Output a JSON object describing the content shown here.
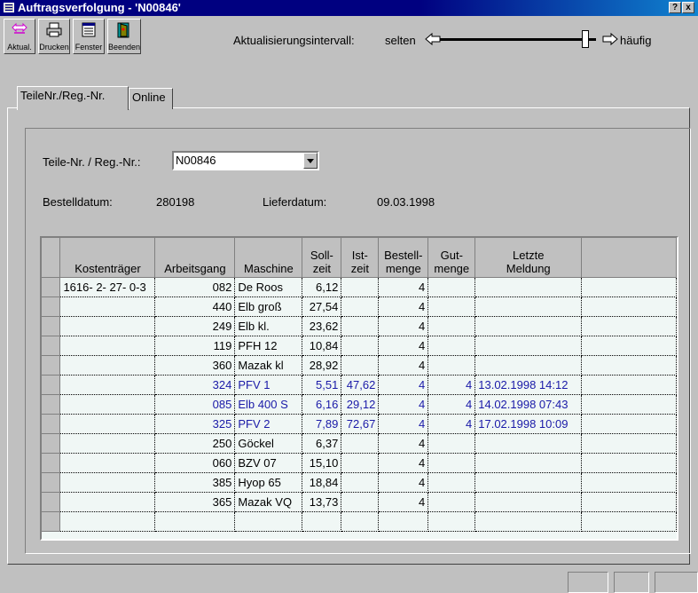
{
  "window": {
    "title": "Auftragsverfolgung - 'N00846'",
    "help_label": "?",
    "close_label": "x"
  },
  "toolbar": {
    "buttons": [
      {
        "label": "Aktual.",
        "icon": "refresh-arrows-icon"
      },
      {
        "label": "Drucken",
        "icon": "printer-icon"
      },
      {
        "label": "Fenster",
        "icon": "window-icon"
      },
      {
        "label": "Beenden",
        "icon": "exit-door-icon"
      }
    ],
    "interval_label": "Aktualisierungsintervall:",
    "slider_left_label": "selten",
    "slider_right_label": "häufig",
    "slider_position": 0.93
  },
  "tabs": [
    {
      "label": "TeileNr./Reg.-Nr.",
      "active": true
    },
    {
      "label": "Online",
      "active": false
    }
  ],
  "form": {
    "part_label": "Teile-Nr. / Reg.-Nr.:",
    "part_value": "N00846",
    "order_date_label": "Bestelldatum:",
    "order_date_value": "280198",
    "delivery_date_label": "Lieferdatum:",
    "delivery_date_value": "09.03.1998"
  },
  "table": {
    "headers": [
      {
        "l1": "",
        "l2": "Kostenträger"
      },
      {
        "l1": "",
        "l2": "Arbeitsgang"
      },
      {
        "l1": "",
        "l2": "Maschine"
      },
      {
        "l1": "Soll-",
        "l2": "zeit"
      },
      {
        "l1": "Ist-",
        "l2": "zeit"
      },
      {
        "l1": "Bestell-",
        "l2": "menge"
      },
      {
        "l1": "Gut-",
        "l2": "menge"
      },
      {
        "l1": "Letzte",
        "l2": "Meldung"
      }
    ],
    "rows": [
      {
        "kt": "1616- 2- 27- 0-3",
        "ag": "082",
        "ma": "De Roos",
        "soll": "6,12",
        "ist": "",
        "best": "4",
        "gut": "",
        "meld": "",
        "hl": false
      },
      {
        "kt": "",
        "ag": "440",
        "ma": "Elb groß",
        "soll": "27,54",
        "ist": "",
        "best": "4",
        "gut": "",
        "meld": "",
        "hl": false
      },
      {
        "kt": "",
        "ag": "249",
        "ma": "Elb kl.",
        "soll": "23,62",
        "ist": "",
        "best": "4",
        "gut": "",
        "meld": "",
        "hl": false
      },
      {
        "kt": "",
        "ag": "119",
        "ma": "PFH 12",
        "soll": "10,84",
        "ist": "",
        "best": "4",
        "gut": "",
        "meld": "",
        "hl": false
      },
      {
        "kt": "",
        "ag": "360",
        "ma": "Mazak kl",
        "soll": "28,92",
        "ist": "",
        "best": "4",
        "gut": "",
        "meld": "",
        "hl": false
      },
      {
        "kt": "",
        "ag": "324",
        "ma": "PFV 1",
        "soll": "5,51",
        "ist": "47,62",
        "best": "4",
        "gut": "4",
        "meld": "13.02.1998 14:12",
        "hl": true
      },
      {
        "kt": "",
        "ag": "085",
        "ma": "Elb 400 S",
        "soll": "6,16",
        "ist": "29,12",
        "best": "4",
        "gut": "4",
        "meld": "14.02.1998 07:43",
        "hl": true
      },
      {
        "kt": "",
        "ag": "325",
        "ma": "PFV 2",
        "soll": "7,89",
        "ist": "72,67",
        "best": "4",
        "gut": "4",
        "meld": "17.02.1998 10:09",
        "hl": true
      },
      {
        "kt": "",
        "ag": "250",
        "ma": "Göckel",
        "soll": "6,37",
        "ist": "",
        "best": "4",
        "gut": "",
        "meld": "",
        "hl": false
      },
      {
        "kt": "",
        "ag": "060",
        "ma": "BZV 07",
        "soll": "15,10",
        "ist": "",
        "best": "4",
        "gut": "",
        "meld": "",
        "hl": false
      },
      {
        "kt": "",
        "ag": "385",
        "ma": "Hyop 65",
        "soll": "18,84",
        "ist": "",
        "best": "4",
        "gut": "",
        "meld": "",
        "hl": false
      },
      {
        "kt": "",
        "ag": "365",
        "ma": "Mazak VQ",
        "soll": "13,73",
        "ist": "",
        "best": "4",
        "gut": "",
        "meld": "",
        "hl": false
      }
    ]
  },
  "colors": {
    "titlebar": "#000080",
    "highlight_text": "#1a1aa8",
    "grid_bg": "#f0f7f5",
    "face": "#c0c0c0"
  }
}
